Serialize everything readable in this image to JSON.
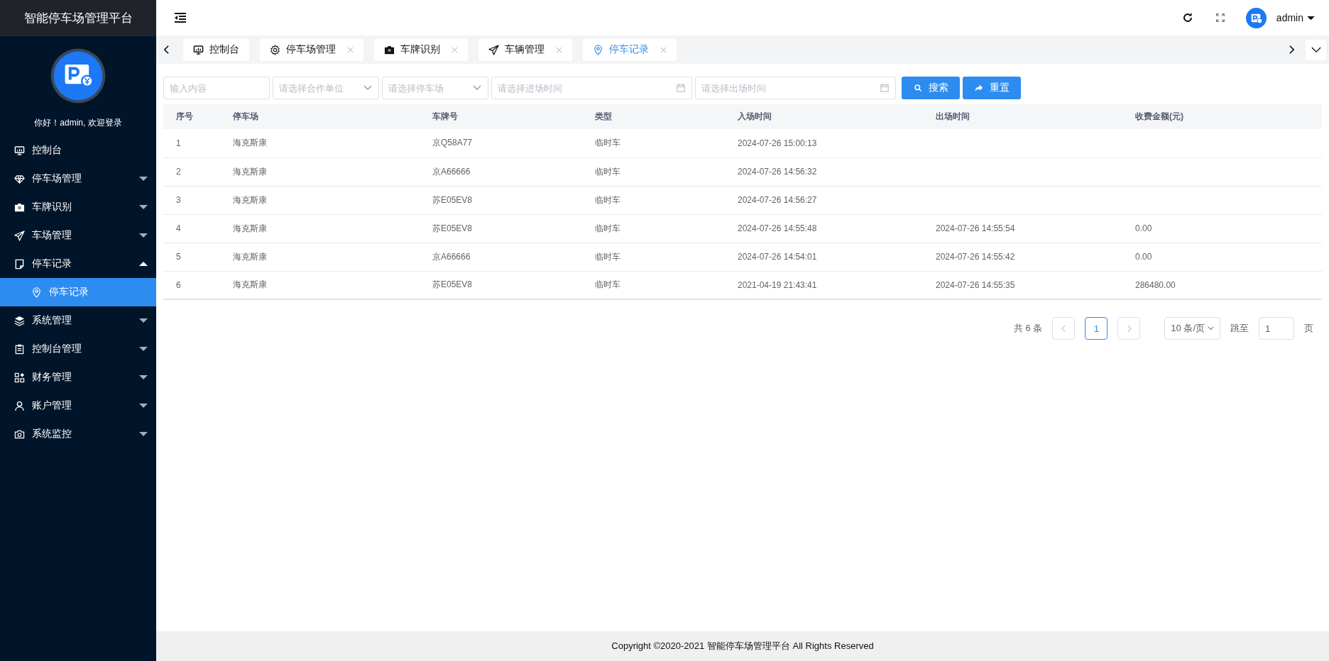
{
  "brand": "智能停车场管理平台",
  "welcome": "你好！admin, 欢迎登录",
  "menu": [
    {
      "label": "控制台",
      "kind": "link"
    },
    {
      "label": "停车场管理",
      "kind": "submenu",
      "expanded": false
    },
    {
      "label": "车牌识别",
      "kind": "submenu",
      "expanded": false
    },
    {
      "label": "车场管理",
      "kind": "submenu",
      "expanded": false
    },
    {
      "label": "停车记录",
      "kind": "submenu",
      "expanded": true,
      "children": [
        {
          "label": "停车记录",
          "selected": true
        }
      ]
    },
    {
      "label": "系统管理",
      "kind": "submenu",
      "expanded": false
    },
    {
      "label": "控制台管理",
      "kind": "submenu",
      "expanded": false
    },
    {
      "label": "财务管理",
      "kind": "submenu",
      "expanded": false
    },
    {
      "label": "账户管理",
      "kind": "submenu",
      "expanded": false
    },
    {
      "label": "系统监控",
      "kind": "submenu",
      "expanded": false
    }
  ],
  "user": {
    "name": "admin"
  },
  "tabs": [
    {
      "label": "控制台",
      "closable": false,
      "selected": false
    },
    {
      "label": "停车场管理",
      "closable": true,
      "selected": false
    },
    {
      "label": "车牌识别",
      "closable": true,
      "selected": false
    },
    {
      "label": "车辆管理",
      "closable": true,
      "selected": false
    },
    {
      "label": "停车记录",
      "closable": true,
      "selected": true
    }
  ],
  "filters": [
    {
      "kind": "input",
      "placeholder": "输入内容"
    },
    {
      "kind": "select",
      "placeholder": "请选择合作单位"
    },
    {
      "kind": "select",
      "placeholder": "请选择停车场"
    },
    {
      "kind": "date",
      "placeholder": "请选择进场时间"
    },
    {
      "kind": "date",
      "placeholder": "请选择出场时间"
    }
  ],
  "buttons": [
    {
      "label": "搜索"
    },
    {
      "label": "重置"
    }
  ],
  "table": {
    "columns": [
      "序号",
      "停车场",
      "车牌号",
      "类型",
      "入场时间",
      "出场时间",
      "收费金额(元)"
    ],
    "rows": [
      [
        "1",
        "海克斯康",
        "京Q58A77",
        "临时车",
        "2024-07-26 15:00:13",
        "",
        ""
      ],
      [
        "2",
        "海克斯康",
        "京A66666",
        "临时车",
        "2024-07-26 14:56:32",
        "",
        ""
      ],
      [
        "3",
        "海克斯康",
        "苏E05EV8",
        "临时车",
        "2024-07-26 14:56:27",
        "",
        ""
      ],
      [
        "4",
        "海克斯康",
        "苏E05EV8",
        "临时车",
        "2024-07-26 14:55:48",
        "2024-07-26 14:55:54",
        "0.00"
      ],
      [
        "5",
        "海克斯康",
        "京A66666",
        "临时车",
        "2024-07-26 14:54:01",
        "2024-07-26 14:55:42",
        "0.00"
      ],
      [
        "6",
        "海克斯康",
        "苏E05EV8",
        "临时车",
        "2021-04-19 21:43:41",
        "2024-07-26 14:55:35",
        "286480.00"
      ]
    ]
  },
  "pagination": {
    "total": "共 6 条",
    "pages": [
      {
        "label": "1",
        "selected": true
      }
    ],
    "page_size": "10 条/页",
    "jump_label": "跳至",
    "jump_value": "1",
    "page_unit": "页"
  },
  "footer": "Copyright ©2020-2021 智能停车场管理平台 All Rights Reserved"
}
